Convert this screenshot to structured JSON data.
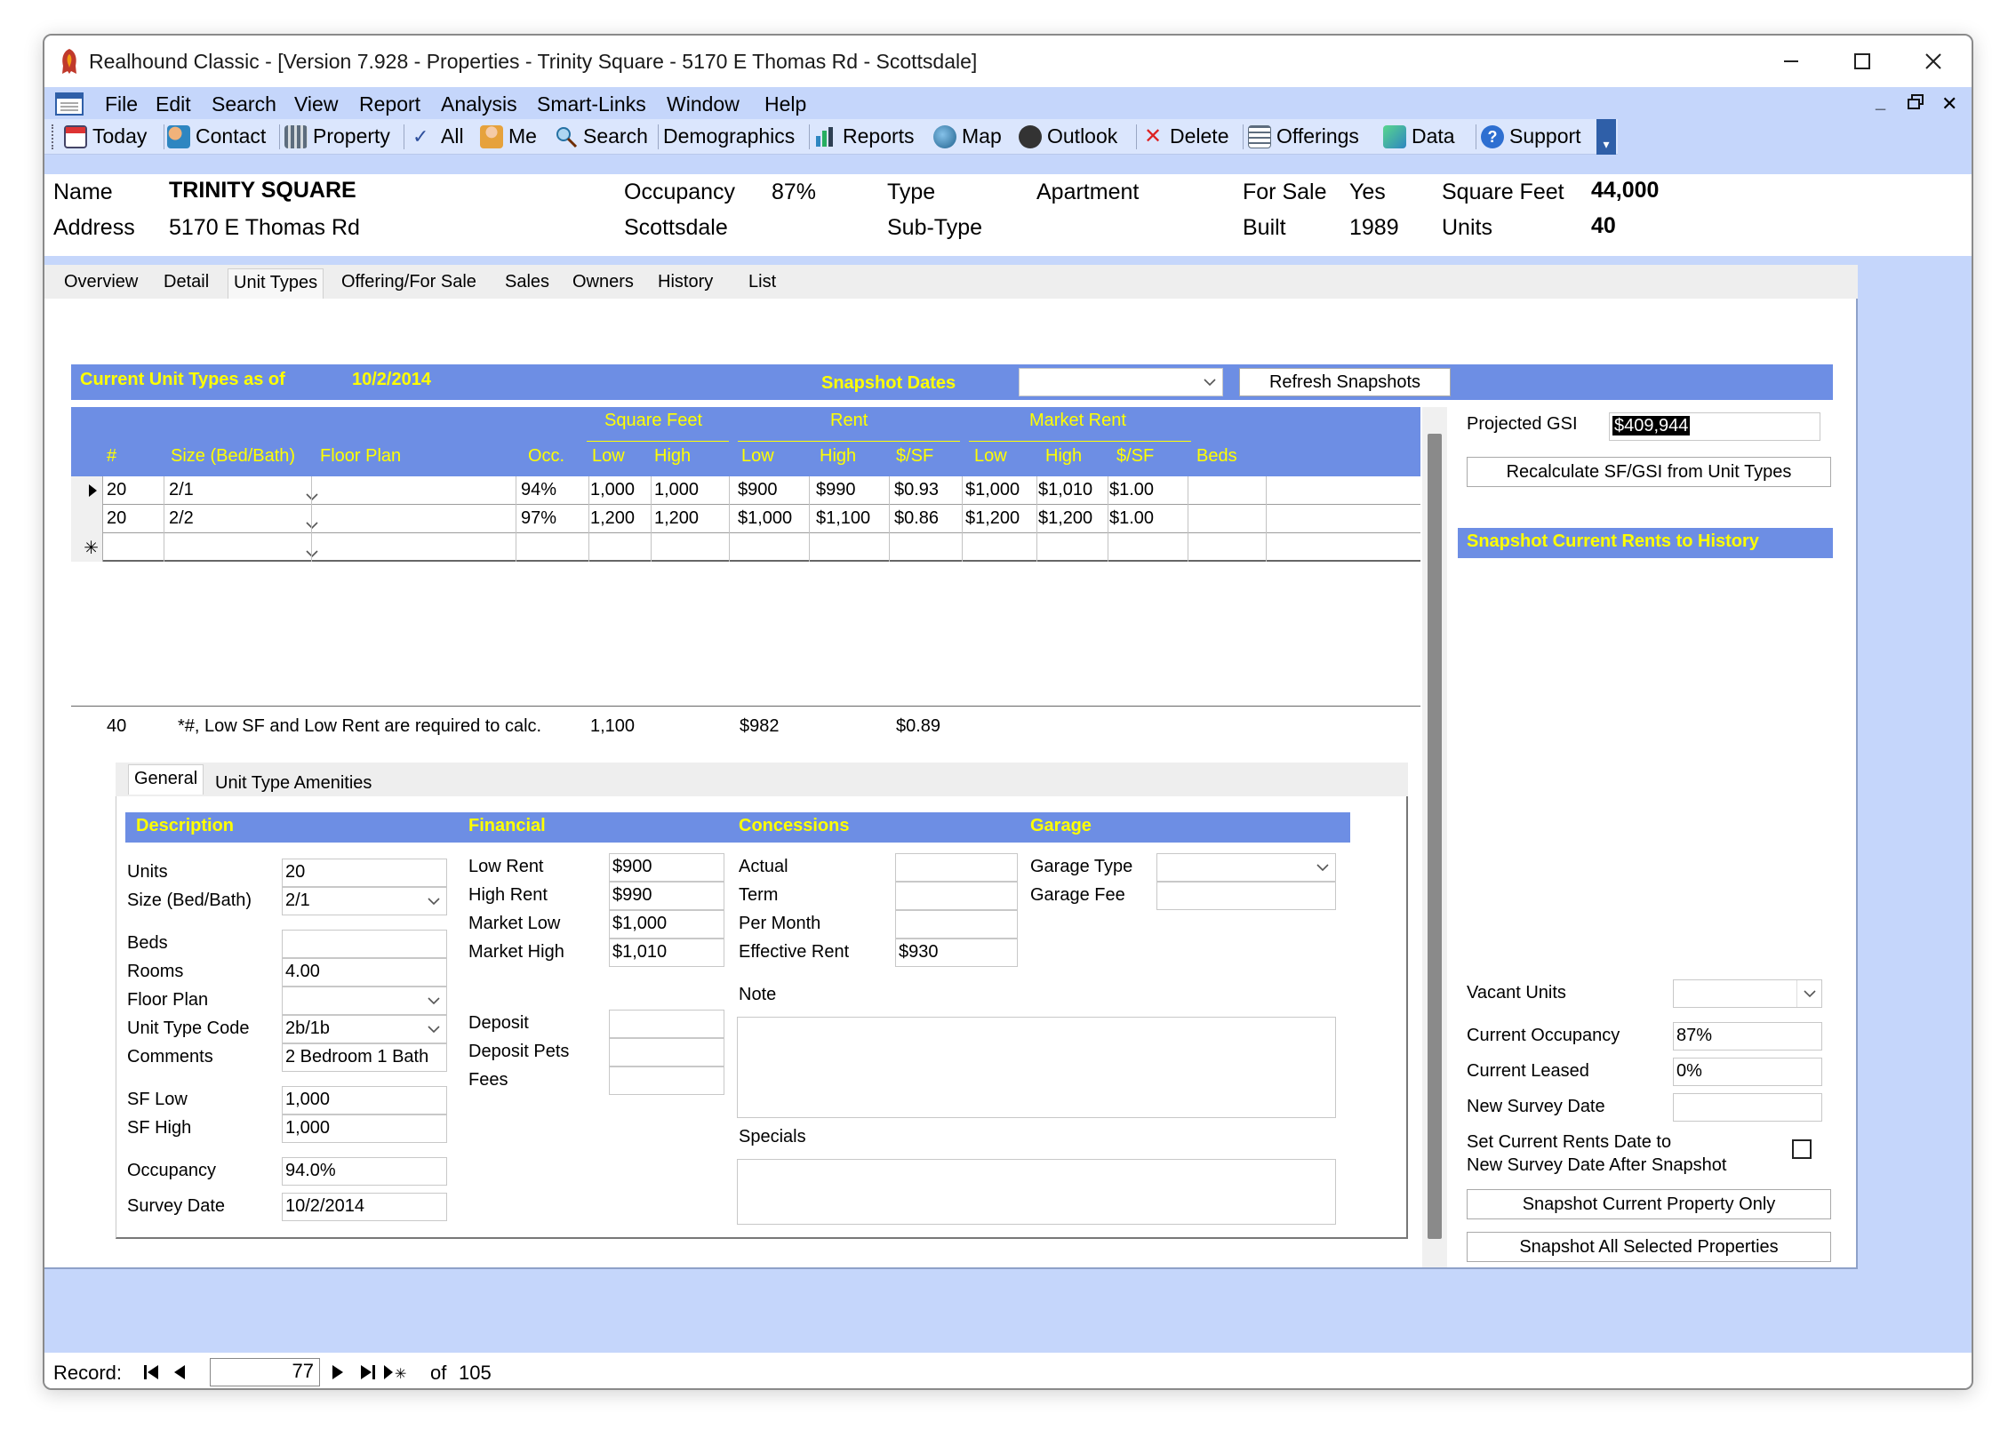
{
  "window": {
    "title": "Realhound Classic - [Version 7.928 - Properties - Trinity Square - 5170 E Thomas Rd - Scottsdale]"
  },
  "menu": [
    "File",
    "Edit",
    "Search",
    "View",
    "Report",
    "Analysis",
    "Smart-Links",
    "Window",
    "Help"
  ],
  "toolbar": {
    "today": "Today",
    "contact": "Contact",
    "property": "Property",
    "all": "All",
    "me": "Me",
    "search": "Search",
    "demographics": "Demographics",
    "reports": "Reports",
    "map": "Map",
    "outlook": "Outlook",
    "delete": "Delete",
    "offerings": "Offerings",
    "data": "Data",
    "support": "Support"
  },
  "header": {
    "name_label": "Name",
    "name_value": "TRINITY SQUARE",
    "address_label": "Address",
    "address_value": "5170 E Thomas Rd",
    "occupancy_label": "Occupancy",
    "occupancy_value": "87%",
    "city": "Scottsdale",
    "type_label": "Type",
    "type_value": "Apartment",
    "subtype_label": "Sub-Type",
    "forsale_label": "For Sale",
    "forsale_value": "Yes",
    "built_label": "Built",
    "built_value": "1989",
    "sqft_label": "Square Feet",
    "sqft_value": "44,000",
    "units_label": "Units",
    "units_value": "40"
  },
  "tabs": [
    "Overview",
    "Detail",
    "Unit Types",
    "Offering/For Sale",
    "Sales",
    "Owners",
    "History",
    "List"
  ],
  "unit_types": {
    "title": "Current Unit Types as of",
    "as_of_date": "10/2/2014",
    "snapshot_dates_label": "Snapshot Dates",
    "snapshot_dates_value": "",
    "refresh_button": "Refresh Snapshots",
    "group_headers": {
      "sqft": "Square Feet",
      "rent": "Rent",
      "market": "Market Rent"
    },
    "columns": {
      "num": "#",
      "size": "Size (Bed/Bath)",
      "floor_plan": "Floor Plan",
      "occ": "Occ.",
      "sf_low": "Low",
      "sf_high": "High",
      "rent_low": "Low",
      "rent_high": "High",
      "rent_psf": "$/SF",
      "mkt_low": "Low",
      "mkt_high": "High",
      "mkt_psf": "$/SF",
      "beds": "Beds"
    },
    "rows": [
      {
        "num": "20",
        "size": "2/1",
        "floor_plan": "",
        "occ": "94%",
        "sf_low": "1,000",
        "sf_high": "1,000",
        "rent_low": "$900",
        "rent_high": "$990",
        "rent_psf": "$0.93",
        "mkt_low": "$1,000",
        "mkt_high": "$1,010",
        "mkt_psf": "$1.00",
        "beds": ""
      },
      {
        "num": "20",
        "size": "2/2",
        "floor_plan": "",
        "occ": "97%",
        "sf_low": "1,200",
        "sf_high": "1,200",
        "rent_low": "$1,000",
        "rent_high": "$1,100",
        "rent_psf": "$0.86",
        "mkt_low": "$1,200",
        "mkt_high": "$1,200",
        "mkt_psf": "$1.00",
        "beds": ""
      }
    ],
    "new_row_marker": "✳",
    "totals": {
      "units": "40",
      "note": "*#, Low SF and Low Rent are required to calc.",
      "sf": "1,100",
      "rent": "$982",
      "psf": "$0.89"
    }
  },
  "right_panel": {
    "projected_gsi_label": "Projected GSI",
    "projected_gsi_value": "$409,944",
    "recalc_button": "Recalculate SF/GSI from Unit Types",
    "snapshot_header": "Snapshot Current Rents to History",
    "vacant_units_label": "Vacant Units",
    "vacant_units_value": "",
    "current_occupancy_label": "Current Occupancy",
    "current_occupancy_value": "87%",
    "current_leased_label": "Current Leased",
    "current_leased_value": "0%",
    "new_survey_date_label": "New Survey Date",
    "new_survey_date_value": "",
    "set_rents_label_1": "Set Current Rents Date to",
    "set_rents_label_2": "New Survey Date After Snapshot",
    "snapshot_current_button": "Snapshot Current Property Only",
    "snapshot_all_button": "Snapshot All Selected Properties"
  },
  "subtabs": [
    "General",
    "Unit Type Amenities"
  ],
  "detail": {
    "sections": {
      "description": "Description",
      "financial": "Financial",
      "concessions": "Concessions",
      "garage": "Garage"
    },
    "units_label": "Units",
    "units_value": "20",
    "size_label": "Size (Bed/Bath)",
    "size_value": "2/1",
    "beds_label": "Beds",
    "beds_value": "",
    "rooms_label": "Rooms",
    "rooms_value": "4.00",
    "floor_plan_label": "Floor Plan",
    "floor_plan_value": "",
    "unit_type_code_label": "Unit Type Code",
    "unit_type_code_value": "2b/1b",
    "comments_label": "Comments",
    "comments_value": "2 Bedroom 1 Bath",
    "sf_low_label": "SF Low",
    "sf_low_value": "1,000",
    "sf_high_label": "SF High",
    "sf_high_value": "1,000",
    "occupancy_label": "Occupancy",
    "occupancy_value": "94.0%",
    "survey_date_label": "Survey Date",
    "survey_date_value": "10/2/2014",
    "low_rent_label": "Low Rent",
    "low_rent_value": "$900",
    "high_rent_label": "High Rent",
    "high_rent_value": "$990",
    "market_low_label": "Market Low",
    "market_low_value": "$1,000",
    "market_high_label": "Market High",
    "market_high_value": "$1,010",
    "deposit_label": "Deposit",
    "deposit_value": "",
    "deposit_pets_label": "Deposit Pets",
    "deposit_pets_value": "",
    "fees_label": "Fees",
    "fees_value": "",
    "actual_label": "Actual",
    "actual_value": "",
    "term_label": "Term",
    "term_value": "",
    "per_month_label": "Per Month",
    "per_month_value": "",
    "effective_rent_label": "Effective Rent",
    "effective_rent_value": "$930",
    "note_label": "Note",
    "note_value": "",
    "specials_label": "Specials",
    "specials_value": "",
    "garage_type_label": "Garage Type",
    "garage_type_value": "",
    "garage_fee_label": "Garage Fee",
    "garage_fee_value": ""
  },
  "record_nav": {
    "label": "Record:",
    "current": "77",
    "of_label": "of",
    "total": "105"
  },
  "colors": {
    "accent_blue": "#6d8ee4",
    "header_yellow": "#ffff00",
    "window_bg": "#c5d6fb"
  }
}
